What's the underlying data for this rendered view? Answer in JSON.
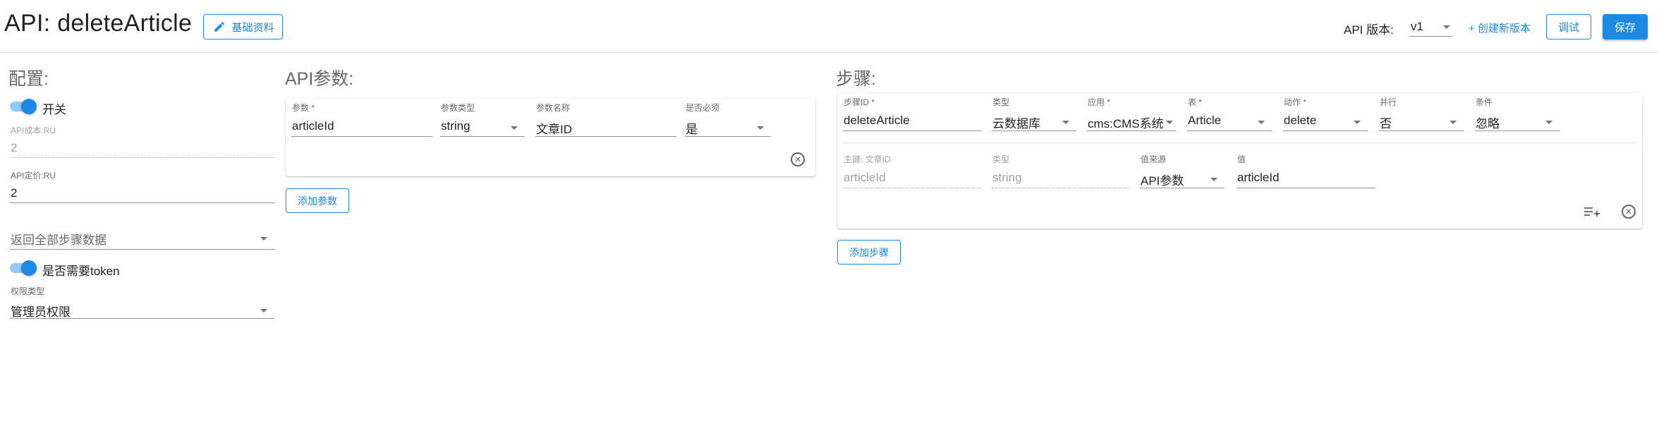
{
  "header": {
    "title": "API: deleteArticle",
    "basic_info_label": "基础资料",
    "version_label": "API 版本:",
    "version_value": "v1",
    "new_version_label": "+ 创建新版本",
    "debug_label": "调试",
    "save_label": "保存"
  },
  "config": {
    "title": "配置:",
    "switch_label": "开关",
    "cost_label": "API成本:RU",
    "cost_value": "2",
    "price_label": "API定价:RU",
    "price_value": "2",
    "return_select": "返回全部步骤数据",
    "token_label": "是否需要token",
    "perm_label": "权限类型",
    "perm_value": "管理员权限"
  },
  "params": {
    "title": "API参数:",
    "param_label": "参数 *",
    "param_value": "articleId",
    "type_label": "参数类型",
    "type_value": "string",
    "name_label": "参数名称",
    "name_value": "文章ID",
    "required_label": "是否必须",
    "required_value": "是",
    "add_label": "添加参数"
  },
  "steps": {
    "title": "步骤:",
    "id_label": "步骤ID *",
    "id_value": "deleteArticle",
    "type_label": "类型",
    "type_value": "云数据库",
    "app_label": "应用 *",
    "app_value": "cms:CMS系统",
    "table_label": "表 *",
    "table_value": "Article",
    "action_label": "动作 *",
    "action_value": "delete",
    "parallel_label": "并行",
    "parallel_value": "否",
    "condition_label": "条件",
    "condition_value": "忽略",
    "pk_label": "主键: 文章ID",
    "pk_value": "articleId",
    "pk_type_label": "类型",
    "pk_type_value": "string",
    "source_label": "值来源",
    "source_value": "API参数",
    "val_label": "值",
    "val_value": "articleId",
    "add_label": "添加步骤"
  },
  "colors": {
    "primary": "#1e88e5",
    "switch_track": "#90caf9"
  }
}
